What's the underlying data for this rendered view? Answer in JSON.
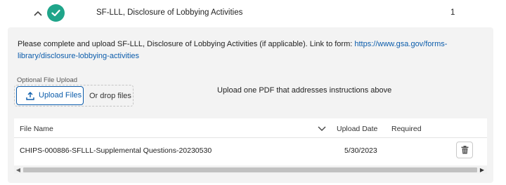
{
  "section": {
    "title": "SF-LLL, Disclosure of Lobbying Activities",
    "count": "1",
    "status_color": "#1fa58a"
  },
  "instructions": {
    "text": "Please complete and upload SF-LLL, Disclosure of Lobbying Activities (if applicable). Link to form: ",
    "link_text": "https://www.gsa.gov/forms-library/disclosure-lobbying-activities",
    "link_href": "https://www.gsa.gov/forms-library/disclosure-lobbying-activities"
  },
  "upload": {
    "optional_label": "Optional File Upload",
    "button_label": "Upload Files",
    "drop_text": "Or drop files",
    "description": "Upload one PDF that addresses instructions above"
  },
  "table": {
    "columns": [
      "File Name",
      "Upload Date",
      "Required"
    ],
    "rows": [
      {
        "file_name": "CHIPS-000886-SFLLL-Supplemental Questions-20230530",
        "upload_date": "5/30/2023",
        "required": ""
      }
    ]
  },
  "icons": {
    "collapse": "chevron-up-icon",
    "status": "checkmark-icon",
    "upload": "upload-icon",
    "sort": "chevron-down-icon",
    "delete": "trash-icon"
  },
  "colors": {
    "link": "#0b5cab",
    "panel_bg": "#f3f3f3"
  }
}
